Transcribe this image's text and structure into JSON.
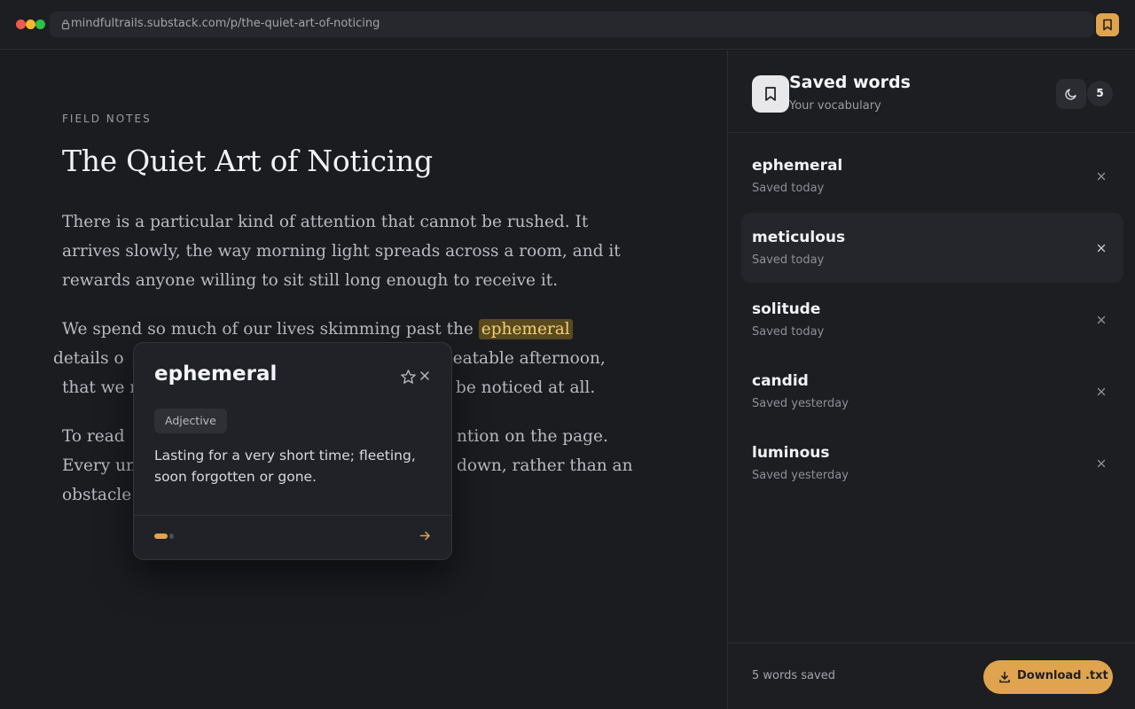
{
  "browser": {
    "url": "mindfultrails.substack.com/p/the-quiet-art-of-noticing",
    "icons": [
      "lock-icon",
      "bookmark-icon"
    ]
  },
  "article": {
    "kicker": "FIELD NOTES",
    "title": "The Quiet Art of Noticing",
    "p1": "There is a particular kind of attention that cannot be rushed. It arrives slowly, the way morning light spreads across a room, and it rewards anyone willing to sit still long enough to receive it.",
    "p2_before": "We spend so much of our lives skimming past the ",
    "p2_highlight": "ephemeral",
    "p2_after": " details o",
    "p2_line2_end": "repeatable afternoon,",
    "p2_line3_start": "that we r",
    "p2_line3_end": "be noticed at all.",
    "p3_line1_start": "To read ",
    "p3_line1_end": "ntion on the page.",
    "p3_line2_start": "Every un",
    "p3_line2_end": "down, rather than an",
    "p3_line3_start": "obstacle"
  },
  "popover": {
    "word": "ephemeral",
    "part_of_speech": "Adjective",
    "definition": "Lasting for a very short time; fleeting, soon forgotten or gone.",
    "icons": [
      "star-icon",
      "close-icon",
      "arrow-right-icon"
    ]
  },
  "sidebar": {
    "title": "Saved words",
    "subtitle": "Your vocabulary",
    "count": "5",
    "items": [
      {
        "word": "ephemeral",
        "saved": "Saved today"
      },
      {
        "word": "meticulous",
        "saved": "Saved today"
      },
      {
        "word": "solitude",
        "saved": "Saved today"
      },
      {
        "word": "candid",
        "saved": "Saved yesterday"
      },
      {
        "word": "luminous",
        "saved": "Saved yesterday"
      }
    ],
    "footer_count": "5 words saved",
    "download_label": "Download .txt",
    "icons": [
      "bookmark-icon",
      "moon-icon",
      "close-icon",
      "download-icon"
    ]
  },
  "colors": {
    "accent": "#e0a44f",
    "highlight_bg": "#5a4a20",
    "highlight_text": "#f3cf70",
    "background": "#1a1c20"
  }
}
